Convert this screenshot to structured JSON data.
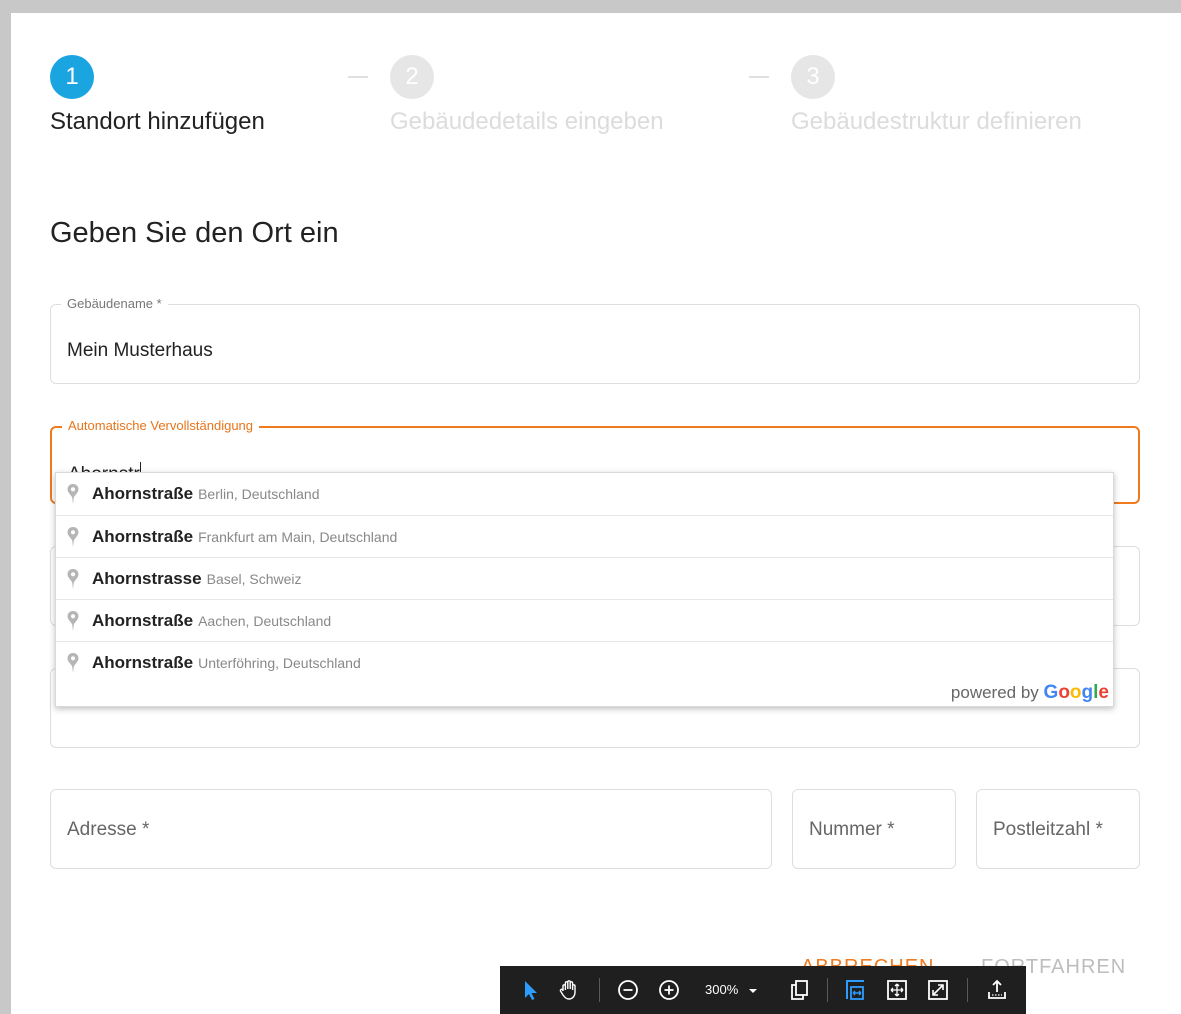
{
  "stepper": {
    "steps": [
      {
        "number": "1",
        "label": "Standort hinzufügen",
        "state": "active"
      },
      {
        "number": "2",
        "label": "Gebäudedetails eingeben",
        "state": "inactive"
      },
      {
        "number": "3",
        "label": "Gebäudestruktur definieren",
        "state": "inactive"
      }
    ]
  },
  "heading": "Geben Sie den Ort ein",
  "fields": {
    "building_name": {
      "legend": "Gebäudename *",
      "value": "Mein Musterhaus"
    },
    "autocomplete": {
      "legend": "Automatische Vervollständigung",
      "value": "Ahornstr"
    },
    "address": {
      "placeholder": "Adresse *"
    },
    "number": {
      "placeholder": "Nummer *"
    },
    "postal_code": {
      "placeholder": "Postleitzahl *"
    }
  },
  "suggestions": [
    {
      "main": "Ahornstraße",
      "secondary": "Berlin, Deutschland"
    },
    {
      "main": "Ahornstraße",
      "secondary": "Frankfurt am Main, Deutschland"
    },
    {
      "main": "Ahornstrasse",
      "secondary": "Basel, Schweiz"
    },
    {
      "main": "Ahornstraße",
      "secondary": "Aachen, Deutschland"
    },
    {
      "main": "Ahornstraße",
      "secondary": "Unterföhring, Deutschland"
    }
  ],
  "powered_by": {
    "prefix": "powered by",
    "brand_letters": [
      "G",
      "o",
      "o",
      "g",
      "l",
      "e"
    ]
  },
  "buttons": {
    "cancel": "ABBRECHEN",
    "next": "FORTFAHREN"
  },
  "toolbar": {
    "zoom": "300%"
  },
  "colors": {
    "accent_blue": "#1aa4e0",
    "accent_orange": "#f07a1e",
    "google": [
      "#4285F4",
      "#EA4335",
      "#FBBC05",
      "#4285F4",
      "#34A853",
      "#EA4335"
    ]
  },
  "icons": [
    "map-pin-icon",
    "select-cursor-icon",
    "hand-tool-icon",
    "zoom-out-icon",
    "zoom-in-icon",
    "dropdown-caret-icon",
    "page-icon",
    "fit-width-icon",
    "fit-page-icon",
    "fullscreen-icon",
    "share-icon"
  ]
}
